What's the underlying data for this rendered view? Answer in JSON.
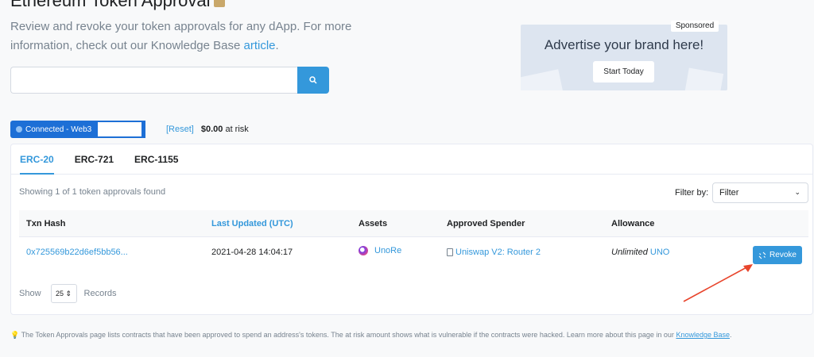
{
  "header": {
    "title": "Ethereum Token Approval",
    "intro_text": "Review and revoke your token approvals for any dApp. For more information, check out our Knowledge Base ",
    "intro_link": "article",
    "intro_end": "."
  },
  "search": {
    "value": "",
    "button_icon": "search-icon"
  },
  "ad": {
    "sponsored": "Sponsored",
    "title": "Advertise your brand here!",
    "cta": "Start Today"
  },
  "connection": {
    "status": "Connected - Web3",
    "reset": "[Reset]",
    "risk_amount": "$0.00",
    "risk_suffix": " at risk"
  },
  "tabs": [
    "ERC-20",
    "ERC-721",
    "ERC-1155"
  ],
  "active_tab": "ERC-20",
  "table": {
    "summary": "Showing 1 of 1 token approvals found",
    "filter_label": "Filter by:",
    "filter_value": "Filter",
    "columns": [
      "Txn Hash",
      "Last Updated (UTC)",
      "Assets",
      "Approved Spender",
      "Allowance"
    ],
    "rows": [
      {
        "txn_hash": "0x725569b22d6ef5bb56...",
        "last_updated": "2021-04-28 14:04:17",
        "asset": "UnoRe",
        "spender": "Uniswap V2: Router 2",
        "allowance_amount": "Unlimited",
        "allowance_token": "UNO",
        "action": "Revoke"
      }
    ]
  },
  "pagination": {
    "show": "Show",
    "page_size": "25",
    "records": "Records"
  },
  "footnote": {
    "text": "The Token Approvals page lists contracts that have been approved to spend an address's tokens. The at risk amount shows what is vulnerable if the contracts were hacked. Learn more about this page in our ",
    "link": "Knowledge Base",
    "end": "."
  },
  "colors": {
    "accent": "#3498db",
    "connected": "#1d6fd6",
    "annotation_arrow": "#e8452c"
  }
}
